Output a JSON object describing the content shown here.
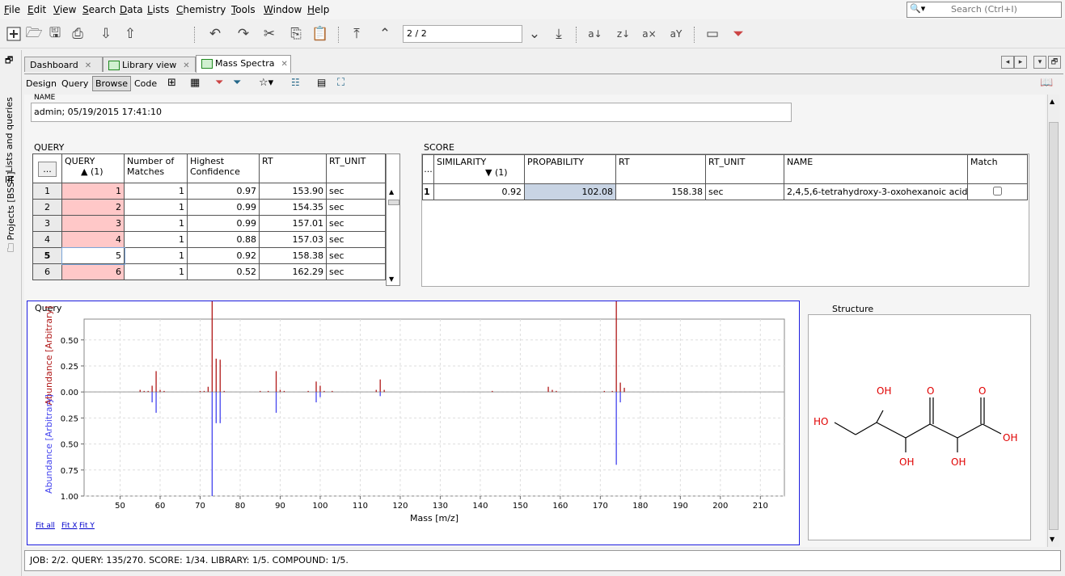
{
  "menu": [
    {
      "label": "File",
      "u": "F",
      "rest": "ile"
    },
    {
      "label": "Edit",
      "u": "E",
      "rest": "dit"
    },
    {
      "label": "View",
      "u": "V",
      "rest": "iew"
    },
    {
      "label": "Search",
      "u": "S",
      "rest": "earch"
    },
    {
      "label": "Data",
      "u": "D",
      "rest": "ata"
    },
    {
      "label": "Lists",
      "u": "L",
      "rest": "ists"
    },
    {
      "label": "Chemistry",
      "u": "C",
      "rest": "hemistry"
    },
    {
      "label": "Tools",
      "u": "T",
      "rest": "ools"
    },
    {
      "label": "Window",
      "u": "W",
      "rest": "indow"
    },
    {
      "label": "Help",
      "u": "H",
      "rest": "elp"
    }
  ],
  "search": {
    "placeholder": "Search (Ctrl+I)"
  },
  "record_nav": {
    "value": "2 / 2"
  },
  "side_tabs": [
    "Projects [BSSN]",
    "Lists and queries"
  ],
  "tabs": [
    "Dashboard",
    "Library view",
    "Mass Spectra"
  ],
  "modes": [
    "Design",
    "Query",
    "Browse",
    "Code"
  ],
  "name_field": {
    "label": "NAME",
    "value": "admin; 05/19/2015 17:41:10"
  },
  "query_table": {
    "label": "QUERY",
    "headers": [
      "...",
      "QUERY",
      "Number of Matches",
      "Highest Confidence",
      "RT",
      "RT_UNIT"
    ],
    "sort_indicator": "▲ (1)",
    "rows": [
      {
        "n": "1",
        "q": "1",
        "m": "1",
        "c": "0.97",
        "rt": "153.90",
        "u": "sec"
      },
      {
        "n": "2",
        "q": "2",
        "m": "1",
        "c": "0.99",
        "rt": "154.35",
        "u": "sec"
      },
      {
        "n": "3",
        "q": "3",
        "m": "1",
        "c": "0.99",
        "rt": "157.01",
        "u": "sec"
      },
      {
        "n": "4",
        "q": "4",
        "m": "1",
        "c": "0.88",
        "rt": "157.03",
        "u": "sec"
      },
      {
        "n": "5",
        "q": "5",
        "m": "1",
        "c": "0.92",
        "rt": "158.38",
        "u": "sec"
      },
      {
        "n": "6",
        "q": "6",
        "m": "1",
        "c": "0.52",
        "rt": "162.29",
        "u": "sec"
      }
    ]
  },
  "score_table": {
    "label": "SCORE",
    "headers": [
      "...",
      "SIMILARITY",
      "PROPABILITY",
      "RT",
      "RT_UNIT",
      "NAME",
      "Match"
    ],
    "sort_indicator": "▼ (1)",
    "rows": [
      {
        "n": "1",
        "sim": "0.92",
        "prob": "102.08",
        "rt": "158.38",
        "u": "sec",
        "name": "2,4,5,6-tetrahydroxy-3-oxohexanoic acid",
        "match": false
      }
    ]
  },
  "query_panel": {
    "label": "Query",
    "links": [
      "Fit all",
      "Fit X",
      "Fit Y"
    ]
  },
  "structure_panel": {
    "label": "Structure",
    "atoms": [
      "HO",
      "OH",
      "O",
      "O",
      "OH",
      "OH",
      "OH"
    ]
  },
  "chart_data": {
    "type": "bar",
    "title": "",
    "xlabel": "Mass [m/z]",
    "ylabel_top": "Abundance [Arbitrary]",
    "ylabel_bottom": "Abundance [Arbitrary]",
    "xlim": [
      41,
      216
    ],
    "ylim": [
      -1.0,
      0.7
    ],
    "xticks": [
      50,
      60,
      70,
      80,
      90,
      100,
      110,
      120,
      130,
      140,
      150,
      160,
      170,
      180,
      190,
      200,
      210
    ],
    "yticks": [
      {
        "v": 0.5,
        "l": "0.50"
      },
      {
        "v": 0.25,
        "l": "0.25"
      },
      {
        "v": 0,
        "l": "0.00"
      },
      {
        "v": -0.25,
        "l": "0.25"
      },
      {
        "v": -0.5,
        "l": "0.50"
      },
      {
        "v": -0.75,
        "l": "0.75"
      },
      {
        "v": -1.0,
        "l": "1.00"
      }
    ],
    "grid": true,
    "series": [
      {
        "color": "#b01818",
        "x": [
          55,
          56,
          57,
          58,
          59,
          60,
          61,
          70,
          71,
          72,
          73,
          74,
          75,
          76,
          85,
          87,
          89,
          90,
          91,
          97,
          99,
          100,
          101,
          103,
          114,
          115,
          116,
          143,
          157,
          158,
          159,
          171,
          173,
          174,
          175,
          176
        ],
        "values": [
          0.02,
          0.01,
          0.01,
          0.06,
          0.2,
          0.02,
          0.01,
          0.01,
          0.01,
          0.05,
          1.0,
          0.32,
          0.31,
          0.01,
          0.01,
          0.01,
          0.2,
          0.02,
          0.01,
          0.01,
          0.1,
          0.06,
          0.01,
          0.01,
          0.02,
          0.12,
          0.02,
          0.01,
          0.05,
          0.02,
          0.01,
          0.01,
          0.01,
          1.0,
          0.09,
          0.04
        ]
      },
      {
        "color": "#4444ee",
        "x": [
          58,
          59,
          73,
          74,
          75,
          89,
          99,
          100,
          115,
          174,
          175
        ],
        "values": [
          -0.1,
          -0.2,
          -1.0,
          -0.3,
          -0.3,
          -0.2,
          -0.1,
          -0.05,
          -0.04,
          -0.7,
          -0.1
        ]
      }
    ]
  },
  "status": {
    "text": "JOB: 2/2.  QUERY: 135/270.  SCORE: 1/34.  LIBRARY: 1/5.  COMPOUND: 1/5."
  }
}
